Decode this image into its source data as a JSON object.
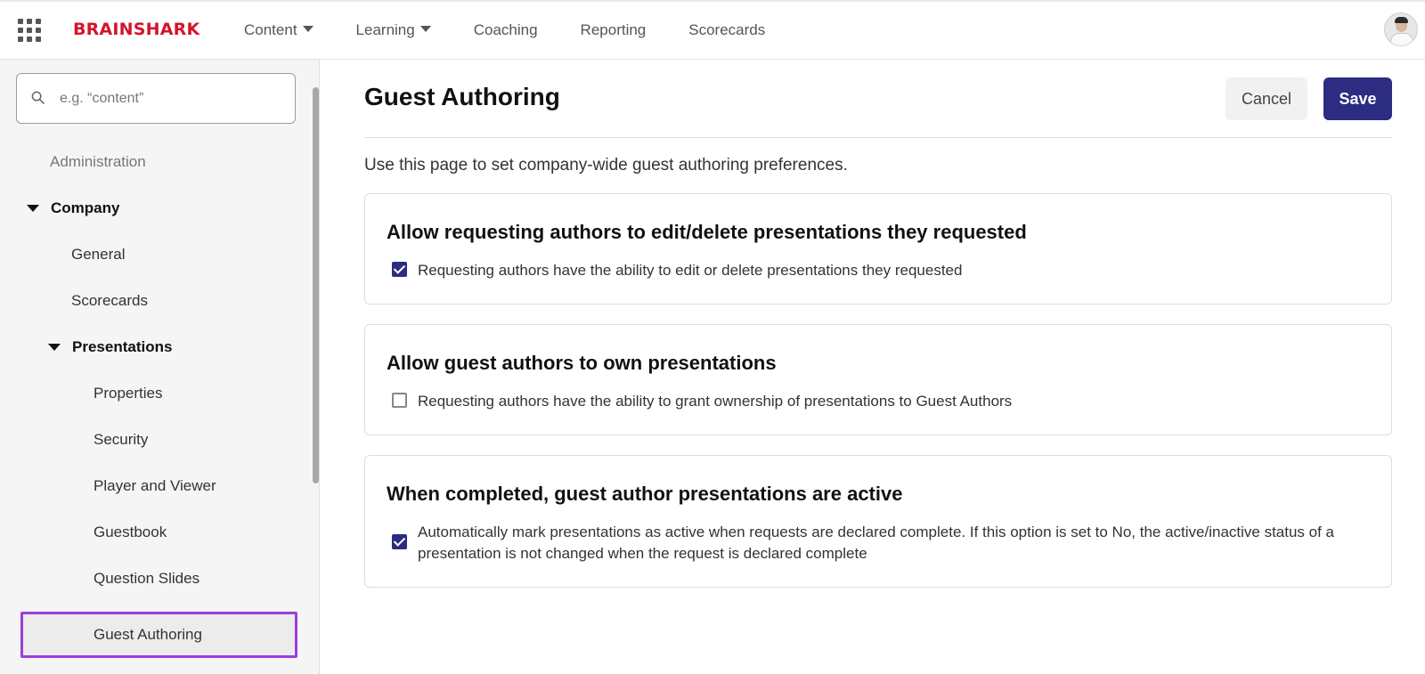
{
  "header": {
    "logo": "BRAINSHARK",
    "nav": [
      {
        "label": "Content",
        "dropdown": true
      },
      {
        "label": "Learning",
        "dropdown": true
      },
      {
        "label": "Coaching",
        "dropdown": false
      },
      {
        "label": "Reporting",
        "dropdown": false
      },
      {
        "label": "Scorecards",
        "dropdown": false
      }
    ]
  },
  "sidebar": {
    "search_placeholder": "e.g. “content”",
    "items": [
      {
        "label": "Administration"
      },
      {
        "label": "Company",
        "expanded": true
      },
      {
        "label": "General"
      },
      {
        "label": "Scorecards"
      },
      {
        "label": "Presentations",
        "expanded": true
      },
      {
        "label": "Properties"
      },
      {
        "label": "Security"
      },
      {
        "label": "Player and Viewer"
      },
      {
        "label": "Guestbook"
      },
      {
        "label": "Question Slides"
      },
      {
        "label": "Guest Authoring",
        "selected": true
      }
    ]
  },
  "main": {
    "title": "Guest Authoring",
    "cancel_label": "Cancel",
    "save_label": "Save",
    "intro": "Use this page to set company-wide guest authoring preferences.",
    "sections": [
      {
        "title": "Allow requesting authors to edit/delete presentations they requested",
        "option_text": "Requesting authors have the ability to edit or delete presentations they requested",
        "checked": true
      },
      {
        "title": "Allow guest authors to own presentations",
        "option_text": "Requesting authors have the ability to grant ownership of presentations to Guest Authors",
        "checked": false
      },
      {
        "title": "When completed, guest author presentations are active",
        "option_text": "Automatically mark presentations as active when requests are declared complete. If this option is set to No, the active/inactive status of a presentation is not changed when the request is declared complete",
        "checked": true
      }
    ]
  },
  "colors": {
    "brand": "#d6132a",
    "primary": "#2c2c82",
    "selection_outline": "#9b3fdc"
  }
}
